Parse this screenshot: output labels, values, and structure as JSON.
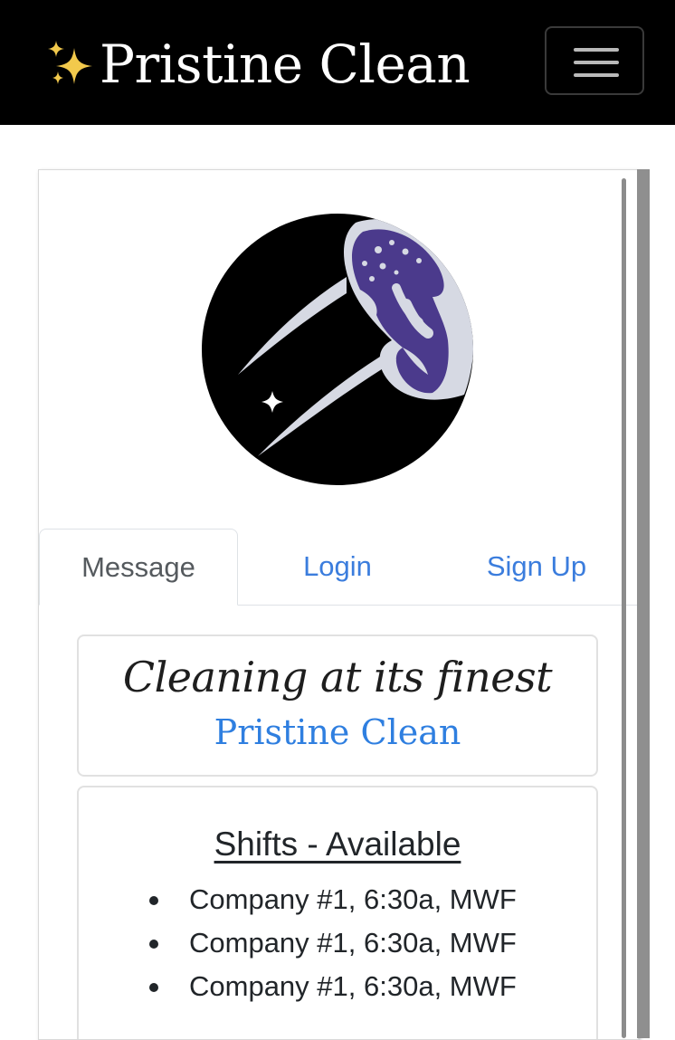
{
  "navbar": {
    "brand_text": "Pristine Clean",
    "sparkle_icon": "sparkles-icon",
    "menu_icon": "hamburger-menu-icon",
    "background": "#000000",
    "sparkle_color": "#f2c94c"
  },
  "logo": {
    "icon": "cleaning-glove-logo",
    "colors": {
      "circle": "#000000",
      "glove": "#d6d9e3",
      "glove_dark": "#4b3a8c"
    }
  },
  "tabs": [
    {
      "label": "Message",
      "active": true
    },
    {
      "label": "Login",
      "active": false
    },
    {
      "label": "Sign Up",
      "active": false
    }
  ],
  "message": {
    "tagline": "Cleaning at its finest",
    "brand": "Pristine Clean"
  },
  "shifts": {
    "title": "Shifts - Available",
    "items": [
      "Company #1, 6:30a, MWF",
      "Company #1, 6:30a, MWF",
      "Company #1, 6:30a, MWF"
    ]
  },
  "colors": {
    "link": "#3b7ddd",
    "brand_blue": "#2f7fe0",
    "text": "#212529"
  }
}
